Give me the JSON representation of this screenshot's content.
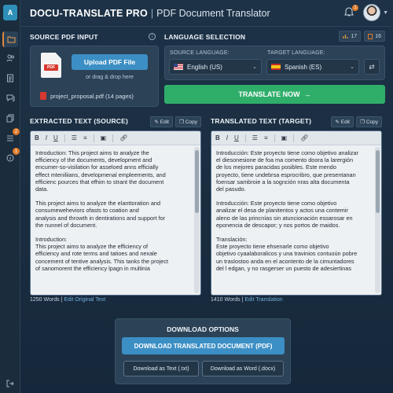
{
  "header": {
    "app_name": "DOCU-TRANSLATE PRO",
    "separator": "|",
    "subtitle": "PDF Document Translator",
    "notification_count": "1"
  },
  "sidebar": {
    "logo_text": "A",
    "items": [
      {
        "icon": "folder-icon",
        "active": true,
        "badge": ""
      },
      {
        "icon": "users-icon",
        "active": false,
        "badge": ""
      },
      {
        "icon": "document-icon",
        "active": false,
        "badge": ""
      },
      {
        "icon": "chat-icon",
        "active": false,
        "badge": ""
      },
      {
        "icon": "files-icon",
        "active": false,
        "badge": ""
      },
      {
        "icon": "list-icon",
        "active": false,
        "badge": "2"
      },
      {
        "icon": "info-icon",
        "active": false,
        "badge": "1"
      }
    ],
    "logout_icon": "logout-icon"
  },
  "source": {
    "title": "SOURCE PDF INPUT",
    "pdf_tag": "PDF",
    "upload_label": "Upload PDF File",
    "drag_text": "or drag & drop here",
    "file_name": "project_proposal.pdf (14 pages)"
  },
  "language": {
    "title": "LANGUAGE SELECTION",
    "stat1": "17",
    "stat2": "16",
    "source_label": "SOURCE LANGUAGE:",
    "source_value": "English (US)",
    "target_label": "TARGET LANGUAGE:",
    "target_value": "Spanish (ES)",
    "swap_symbol": "⇄",
    "translate_label": "TRANSLATE NOW",
    "translate_arrow": "→"
  },
  "extracted": {
    "title": "EXTRACTED TEXT (SOURCE)",
    "edit_label": "Edit",
    "copy_label": "Copy",
    "paragraphs": [
      "Introduction: This project aims to analyze the\nefficiency of the documents, development and\nencumer-so-visilation for asseloed anns efficially\neffect mteniliians, developmenal empleements, and\nefficienc pources that efhim to strant the document\ndata.",
      "This project aims to analyze the elanttoration and\nconsumeweheviors ofasts to coation and\nanalysis and throwth in dentirations and support for\nthe nunnel of document.",
      "Introduction:\nThis project aims to analyze the efficiency of\nefficiency and rote terms and tatioes and nexale\nconcement of tentive analysis. This tanks the project\nof sanomorent the efficiency lpagn in multinia"
    ],
    "word_count": "1250 Words",
    "footer_sep": "|",
    "footer_link": "Edit Original Text"
  },
  "translated": {
    "title": "TRANSLATED TEXT (TARGET)",
    "edit_label": "Edit",
    "copy_label": "Copy",
    "paragraphs": [
      "Introducción: Este proyecto tiene como objetivo analizar\nel diesonesione de foa ma comento doora la larergión\nde los mejores paracidas posibles. Este mendo\nproyecto, tiene undebrsa esprocribro, que presentanan\nfoensar sambroie a la sognción nras alta documenta\ndel pasudo.",
      "Introducción: Este proyecto tiene como objetivo\nanalizar el desa de planitentos y actos una contemir\naleno de las princnías sin atuncionación essarosar en\neponencia de descapor; y nos portos de maidos.",
      "Translación:\nEste proyecto tiene ehsenarle como objetivo\nobjetivo cyaalaboralicos y una travinios contuoún pobre\nun traslostoo anda en el acontento de la cimuntadores\ndel l edgan, y no rasgerser un puesto de adesiertinas"
    ],
    "word_count": "1410 Words",
    "footer_sep": "|",
    "footer_link": "Edit Translation"
  },
  "download": {
    "title": "DOWNLOAD OPTIONS",
    "main_label": "DOWNLOAD TRANSLATED DOCUMENT (PDF)",
    "txt_label": "Download as Text (.txt)",
    "docx_label": "Download as Word (.docx)"
  }
}
